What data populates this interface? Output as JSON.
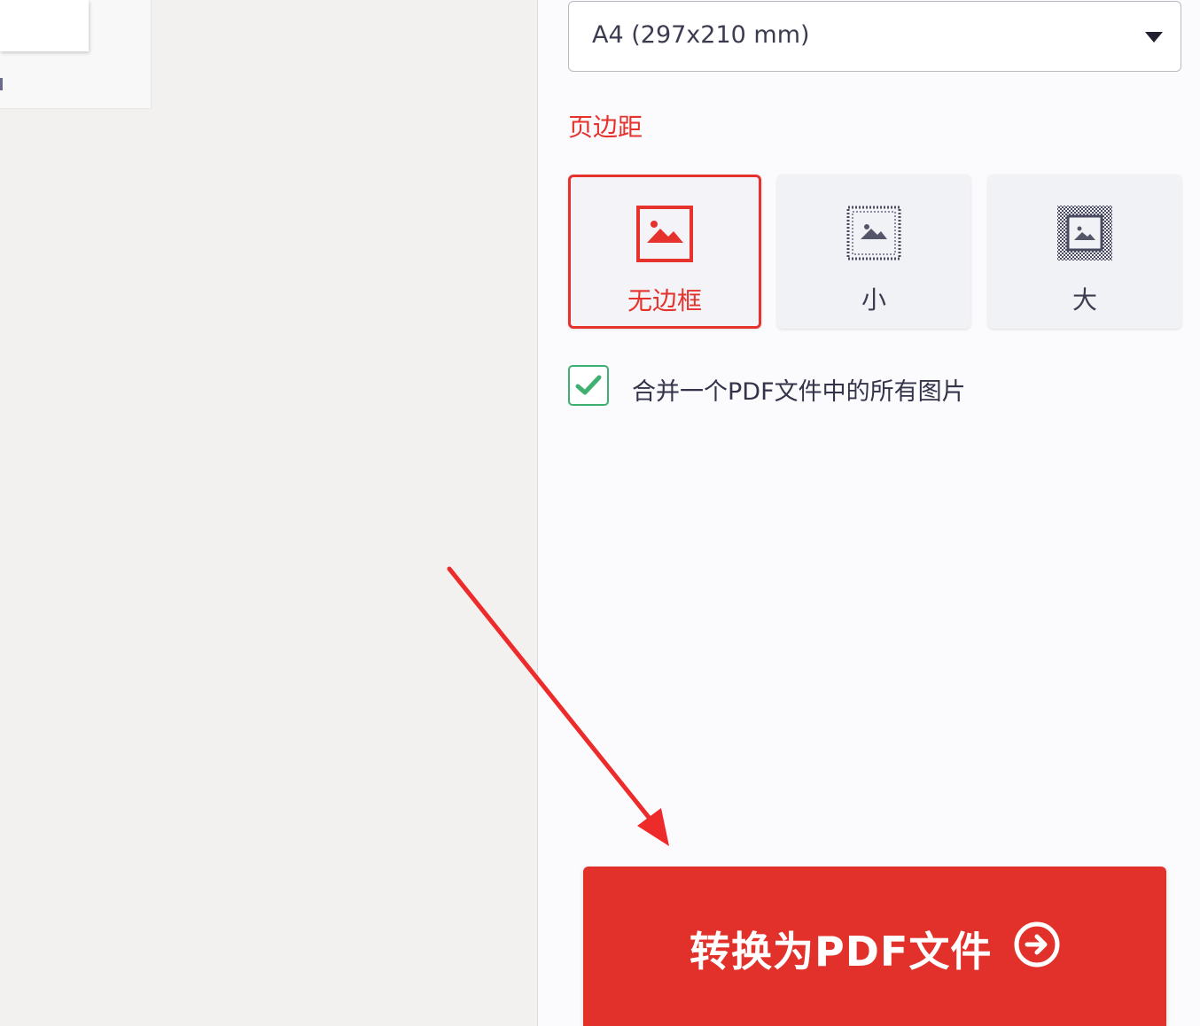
{
  "page_size": {
    "label": "A4 (297x210 mm)"
  },
  "margin": {
    "label": "页边距",
    "options": [
      {
        "label": "无边框",
        "icon": "image-no-border-icon",
        "selected": true
      },
      {
        "label": "小",
        "icon": "image-small-margin-icon",
        "selected": false
      },
      {
        "label": "大",
        "icon": "image-large-margin-icon",
        "selected": false
      }
    ]
  },
  "merge": {
    "checked": true,
    "label": "合并一个PDF文件中的所有图片"
  },
  "convert_button": {
    "label": "转换为PDF文件",
    "icon": "arrow-right-circle-icon"
  },
  "colors": {
    "accent": "#e5322d",
    "button": "#e2312a",
    "check": "#3fb071",
    "annotation_arrow": "#ee2b2b"
  }
}
